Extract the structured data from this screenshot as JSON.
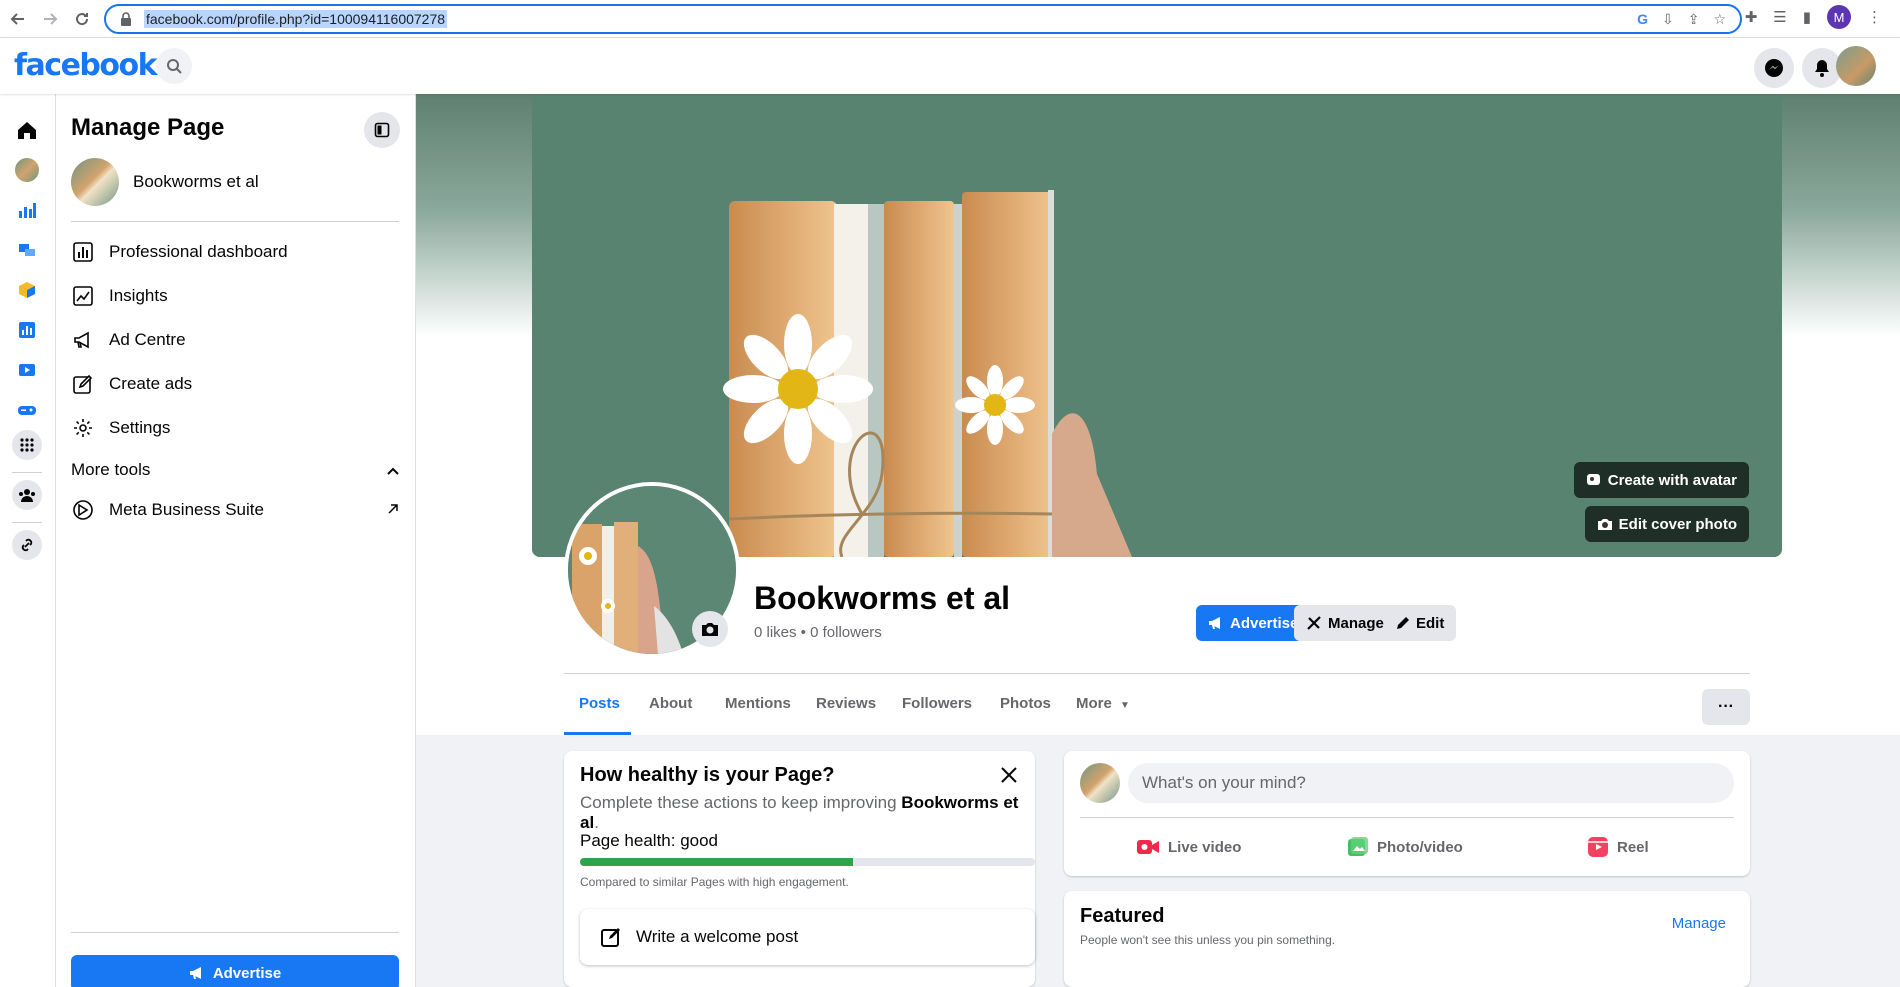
{
  "browser": {
    "url": "facebook.com/profile.php?id=100094116007278",
    "profile_initial": "M"
  },
  "fb": {
    "logo": "facebook"
  },
  "sidebar": {
    "title": "Manage Page",
    "page_name": "Bookworms et al",
    "items": [
      {
        "label": "Professional dashboard",
        "icon": "dashboard-icon"
      },
      {
        "label": "Insights",
        "icon": "insights-icon"
      },
      {
        "label": "Ad Centre",
        "icon": "megaphone-icon"
      },
      {
        "label": "Create ads",
        "icon": "pencil-square-icon"
      },
      {
        "label": "Settings",
        "icon": "gear-icon"
      }
    ],
    "more_tools": "More tools",
    "meta_business_suite": "Meta Business Suite",
    "advertise": "Advertise"
  },
  "cover": {
    "create_with_avatar": "Create with avatar",
    "edit_cover_photo": "Edit cover photo"
  },
  "profile": {
    "name": "Bookworms et al",
    "stats": "0 likes • 0 followers"
  },
  "actions": {
    "advertise": "Advertise",
    "manage": "Manage",
    "edit": "Edit"
  },
  "tabs": [
    "Posts",
    "About",
    "Mentions",
    "Reviews",
    "Followers",
    "Photos",
    "More"
  ],
  "tabs_more_button": "···",
  "health": {
    "title": "How healthy is your Page?",
    "subtitle_prefix": "Complete these actions to keep improving ",
    "subtitle_page": "Bookworms et al",
    "subtitle_suffix": ".",
    "status": "Page health: good",
    "progress": 0.6,
    "note": "Compared to similar Pages with high engagement.",
    "welcome_post": "Write a welcome post"
  },
  "composer": {
    "placeholder": "What's on your mind?",
    "live_video": "Live video",
    "photo_video": "Photo/video",
    "reel": "Reel"
  },
  "featured": {
    "title": "Featured",
    "subtitle": "People won't see this unless you pin something.",
    "manage": "Manage"
  },
  "colors": {
    "brand": "#1877f2",
    "health_green": "#31a24c",
    "cover_green": "#5d8775"
  }
}
